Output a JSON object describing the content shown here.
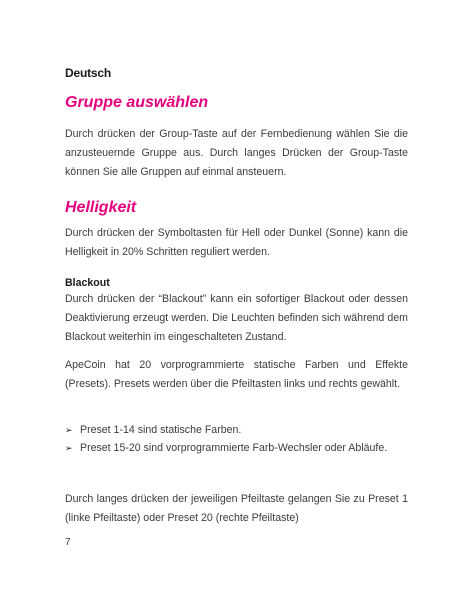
{
  "language": "Deutsch",
  "sections": {
    "group": {
      "heading": "Gruppe auswählen",
      "text": "Durch drücken der Group-Taste auf der Fernbedienung wählen Sie die anzusteuernde Gruppe aus. Durch langes Drücken der Group-Taste können Sie alle Gruppen auf einmal ansteuern."
    },
    "brightness": {
      "heading": "Helligkeit",
      "text": "Durch drücken der Symboltasten für Hell oder Dunkel (Sonne) kann die Helligkeit in 20% Schritten reguliert werden."
    },
    "blackout": {
      "subheading": "Blackout",
      "text": "Durch drücken der “Blackout” kann ein sofortiger Blackout oder dessen Deaktivierung erzeugt werden. Die Leuchten befinden sich während dem Blackout weiterhin im eingeschalteten Zustand."
    },
    "presets": {
      "text": "ApeCoin hat 20 vorprogrammierte statische Farben und Effekte (Presets). Presets werden über die Pfeiltasten links und rechts gewählt.",
      "bullets": [
        "Preset 1-14 sind statische Farben.",
        "Preset 15-20 sind vorprogrammierte Farb-Wechsler oder Abläufe."
      ],
      "bullet_glyph": "➢"
    },
    "long_press": {
      "text": "Durch langes drücken der jeweiligen Pfeiltaste gelangen Sie zu Preset 1 (linke Pfeiltaste) oder Preset 20 (rechte Pfeiltaste)"
    }
  },
  "page_number": "7",
  "colors": {
    "heading": "#e6007e",
    "text": "#3c3c3c"
  }
}
